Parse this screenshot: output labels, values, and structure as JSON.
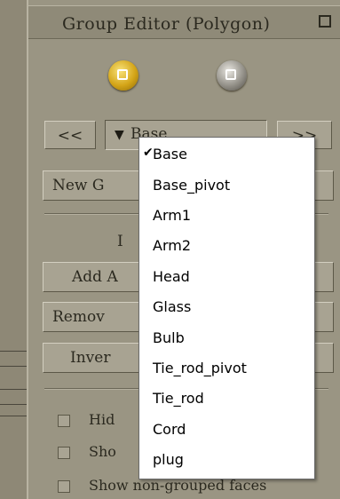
{
  "window": {
    "title": "Group Editor  (Polygon)"
  },
  "nav": {
    "prev_label": "<<",
    "next_label": ">>"
  },
  "combo": {
    "value": "Base",
    "arrow": "▼"
  },
  "buttons": {
    "new_group": "New G",
    "add": "Add A",
    "remove": "Remov",
    "invert": "Inver"
  },
  "section_label": "I",
  "checkboxes": [
    {
      "label": "Hid"
    },
    {
      "label": "Sho"
    },
    {
      "label": "Show non-grouped faces"
    }
  ],
  "menu": {
    "checkmark": "✔",
    "items": [
      {
        "label": "Base",
        "checked": true
      },
      {
        "label": "Base_pivot",
        "checked": false
      },
      {
        "label": "Arm1",
        "checked": false
      },
      {
        "label": "Arm2",
        "checked": false
      },
      {
        "label": "Head",
        "checked": false
      },
      {
        "label": "Glass",
        "checked": false
      },
      {
        "label": "Bulb",
        "checked": false
      },
      {
        "label": "Tie_rod_pivot",
        "checked": false
      },
      {
        "label": "Tie_rod",
        "checked": false
      },
      {
        "label": "Cord",
        "checked": false
      },
      {
        "label": "plug",
        "checked": false
      }
    ]
  },
  "colors": {
    "panel": "#9a9583",
    "menu_bg": "#ffffff",
    "gold_button": "#d4a518"
  }
}
